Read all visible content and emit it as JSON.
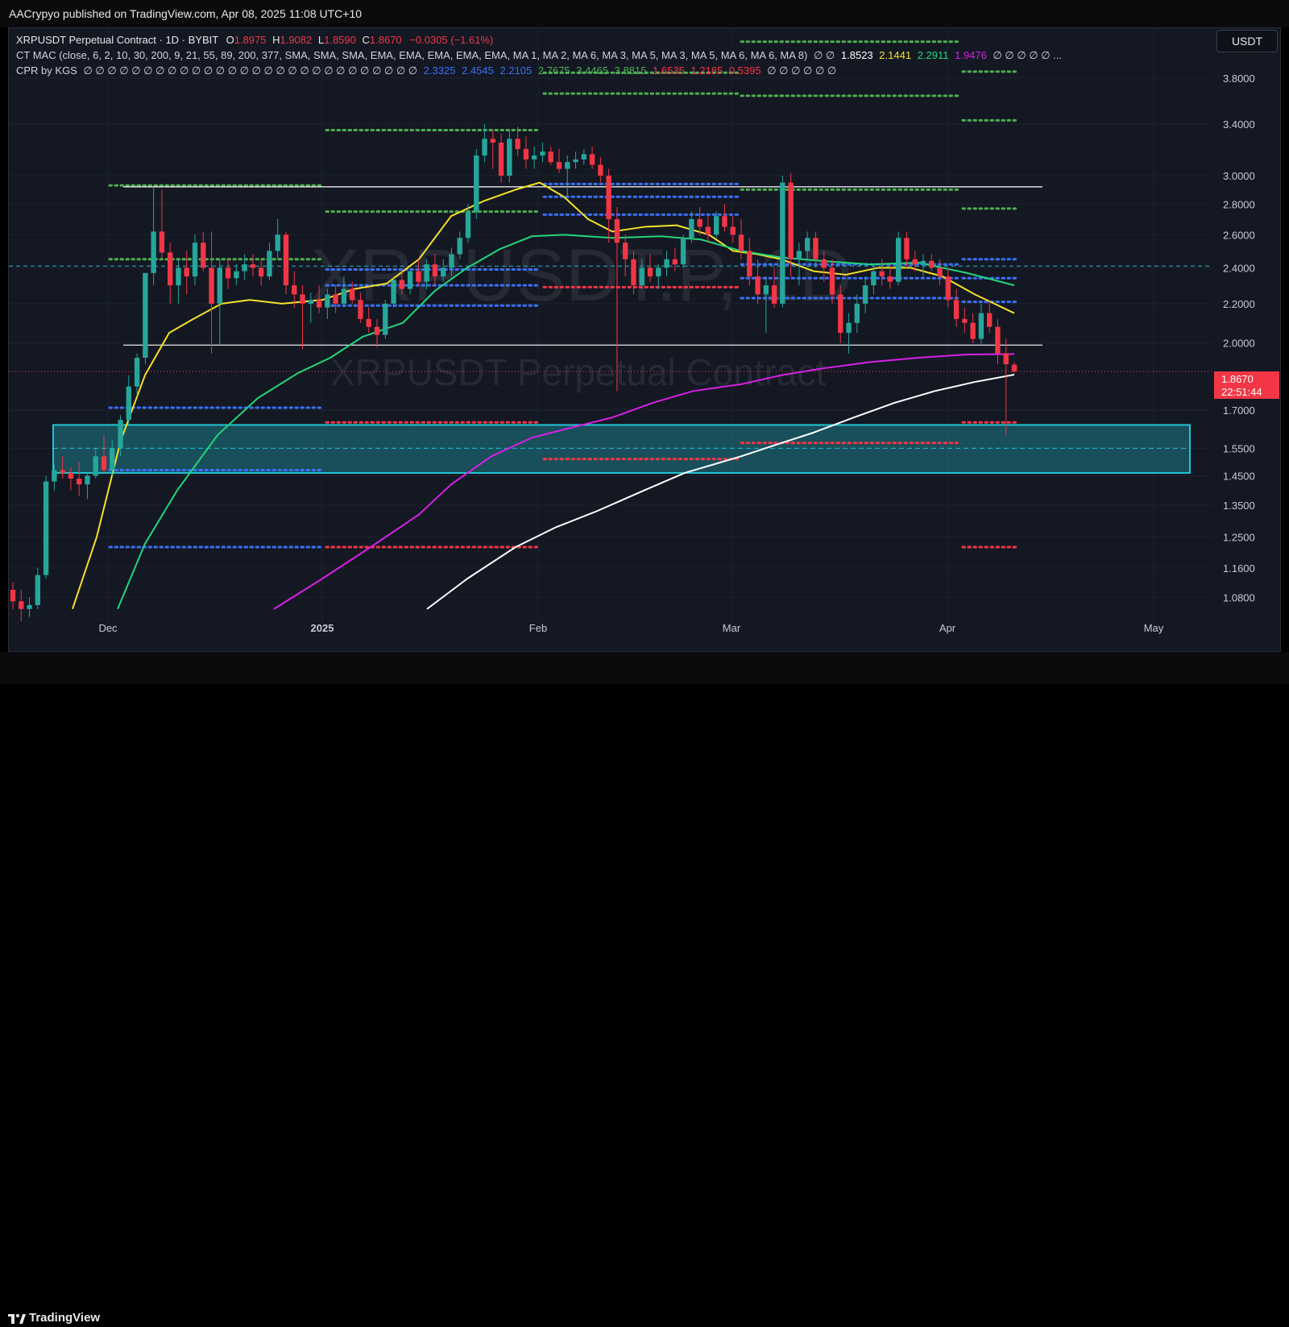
{
  "publisher": "AACrypyo published on TradingView.com, Apr 08, 2025 11:08 UTC+10",
  "legend": {
    "symbol": "XRPUSDT Perpetual Contract · 1D · BYBIT",
    "o_label": "O",
    "o": "1.8975",
    "h_label": "H",
    "h": "1.9082",
    "l_label": "L",
    "l": "1.8590",
    "c_label": "C",
    "c": "1.8670",
    "change": "−0.0305 (−1.61%)",
    "ctmac_label": "CT MAC (close, 6, 2, 10, 30, 200, 9, 21, 55, 89, 200, 377, SMA, SMA, SMA, EMA, EMA, EMA, EMA, EMA, MA 1, MA 2, MA 6, MA 3, MA 5, MA 3, MA 5, MA 6, MA 6, MA 8)",
    "ctmac_empty_a": "∅ ∅",
    "ctmac_v1": "1.8523",
    "ctmac_v2": "2.1441",
    "ctmac_v3": "2.2911",
    "ctmac_v4": "1.9476",
    "ctmac_empty_b": "∅ ∅ ∅ ∅ ∅ ...",
    "cpr_label": "CPR by KGS",
    "cpr_empty_a": "∅ ∅ ∅ ∅ ∅ ∅ ∅ ∅ ∅ ∅ ∅ ∅ ∅ ∅ ∅ ∅ ∅ ∅ ∅ ∅ ∅ ∅ ∅ ∅ ∅ ∅ ∅ ∅",
    "cpr_b1": "2.3325",
    "cpr_b2": "2.4545",
    "cpr_b3": "2.2105",
    "cpr_g1": "2.7675",
    "cpr_g2": "3.4465",
    "cpr_g3": "3.8815",
    "cpr_r1": "1.6535",
    "cpr_r2": "1.2185",
    "cpr_r3": "0.5395",
    "cpr_empty_b": "∅ ∅ ∅ ∅ ∅ ∅"
  },
  "currency_button": "USDT",
  "last_price": "1.8670",
  "countdown": "22:51:44",
  "watermark_big": "XRPUSDT.P, 1D",
  "watermark_small": "XRPUSDT Perpetual Contract",
  "footer_brand": "TradingView",
  "colors": {
    "up": "#26a69a",
    "down": "#f23645",
    "bg": "#141823",
    "yellow": "#f5e12a",
    "green": "#22d67a",
    "magenta": "#d81fe6",
    "white": "#ffffff",
    "zone": "#21c4d4"
  },
  "chart_data": {
    "type": "candlestick",
    "price_axis": [
      "3.8000",
      "3.4000",
      "3.0000",
      "2.8000",
      "2.6000",
      "2.4000",
      "2.2000",
      "2.0000",
      "1.7000",
      "1.5500",
      "1.4500",
      "1.3500",
      "1.2500",
      "1.1600",
      "1.0800"
    ],
    "time_axis": [
      "Dec",
      "2025",
      "Feb",
      "Mar",
      "Apr",
      "May"
    ],
    "scale": "log",
    "ohlc": [
      [
        1.1,
        1.12,
        1.05,
        1.07
      ],
      [
        1.07,
        1.1,
        1.02,
        1.05
      ],
      [
        1.05,
        1.08,
        1.03,
        1.06
      ],
      [
        1.06,
        1.16,
        1.05,
        1.14
      ],
      [
        1.14,
        1.45,
        1.13,
        1.43
      ],
      [
        1.43,
        1.49,
        1.4,
        1.47
      ],
      [
        1.47,
        1.52,
        1.44,
        1.46
      ],
      [
        1.46,
        1.48,
        1.4,
        1.44
      ],
      [
        1.44,
        1.5,
        1.38,
        1.42
      ],
      [
        1.42,
        1.46,
        1.37,
        1.45
      ],
      [
        1.45,
        1.55,
        1.44,
        1.52
      ],
      [
        1.52,
        1.6,
        1.46,
        1.47
      ],
      [
        1.47,
        1.58,
        1.45,
        1.55
      ],
      [
        1.55,
        1.68,
        1.52,
        1.66
      ],
      [
        1.66,
        1.85,
        1.64,
        1.8
      ],
      [
        1.8,
        1.95,
        1.76,
        1.93
      ],
      [
        1.93,
        2.2,
        1.9,
        2.37
      ],
      [
        2.37,
        2.92,
        2.3,
        2.62
      ],
      [
        2.62,
        2.9,
        2.45,
        2.49
      ],
      [
        2.49,
        2.55,
        2.2,
        2.3
      ],
      [
        2.3,
        2.45,
        2.2,
        2.4
      ],
      [
        2.4,
        2.5,
        2.25,
        2.35
      ],
      [
        2.35,
        2.6,
        2.3,
        2.55
      ],
      [
        2.55,
        2.62,
        2.38,
        2.4
      ],
      [
        2.4,
        2.62,
        1.95,
        2.2
      ],
      [
        2.2,
        2.45,
        1.99,
        2.4
      ],
      [
        2.4,
        2.45,
        2.28,
        2.34
      ],
      [
        2.34,
        2.42,
        2.3,
        2.38
      ],
      [
        2.38,
        2.48,
        2.33,
        2.42
      ],
      [
        2.42,
        2.48,
        2.35,
        2.4
      ],
      [
        2.4,
        2.45,
        2.3,
        2.35
      ],
      [
        2.35,
        2.55,
        2.33,
        2.5
      ],
      [
        2.5,
        2.7,
        2.45,
        2.6
      ],
      [
        2.6,
        2.62,
        2.25,
        2.3
      ],
      [
        2.3,
        2.38,
        2.18,
        2.25
      ],
      [
        2.25,
        2.3,
        1.97,
        2.2
      ],
      [
        2.2,
        2.26,
        2.1,
        2.22
      ],
      [
        2.22,
        2.3,
        2.15,
        2.18
      ],
      [
        2.18,
        2.28,
        2.12,
        2.25
      ],
      [
        2.25,
        2.3,
        2.15,
        2.2
      ],
      [
        2.2,
        2.35,
        2.18,
        2.28
      ],
      [
        2.28,
        2.32,
        2.2,
        2.22
      ],
      [
        2.22,
        2.26,
        2.1,
        2.12
      ],
      [
        2.12,
        2.18,
        2.05,
        2.08
      ],
      [
        2.08,
        2.12,
        1.98,
        2.04
      ],
      [
        2.04,
        2.22,
        2.02,
        2.2
      ],
      [
        2.2,
        2.35,
        2.18,
        2.33
      ],
      [
        2.33,
        2.38,
        2.25,
        2.28
      ],
      [
        2.28,
        2.4,
        2.25,
        2.38
      ],
      [
        2.38,
        2.45,
        2.3,
        2.32
      ],
      [
        2.32,
        2.45,
        2.28,
        2.42
      ],
      [
        2.42,
        2.48,
        2.3,
        2.35
      ],
      [
        2.35,
        2.45,
        2.32,
        2.4
      ],
      [
        2.4,
        2.52,
        2.35,
        2.48
      ],
      [
        2.48,
        2.62,
        2.45,
        2.58
      ],
      [
        2.58,
        2.8,
        2.55,
        2.75
      ],
      [
        2.75,
        3.2,
        2.7,
        3.15
      ],
      [
        3.15,
        3.4,
        3.1,
        3.28
      ],
      [
        3.28,
        3.35,
        3.05,
        3.25
      ],
      [
        3.25,
        3.32,
        2.95,
        3.0
      ],
      [
        3.0,
        3.35,
        2.95,
        3.28
      ],
      [
        3.28,
        3.38,
        3.15,
        3.2
      ],
      [
        3.2,
        3.3,
        3.05,
        3.12
      ],
      [
        3.12,
        3.22,
        3.05,
        3.15
      ],
      [
        3.15,
        3.25,
        3.1,
        3.18
      ],
      [
        3.18,
        3.22,
        3.08,
        3.1
      ],
      [
        3.1,
        3.2,
        3.02,
        3.05
      ],
      [
        3.05,
        3.15,
        2.85,
        3.1
      ],
      [
        3.1,
        3.18,
        3.05,
        3.12
      ],
      [
        3.12,
        3.2,
        3.08,
        3.16
      ],
      [
        3.16,
        3.22,
        3.05,
        3.08
      ],
      [
        3.08,
        3.14,
        2.95,
        3.0
      ],
      [
        3.0,
        3.05,
        2.55,
        2.7
      ],
      [
        2.7,
        2.78,
        1.78,
        2.55
      ],
      [
        2.55,
        2.6,
        2.35,
        2.45
      ],
      [
        2.45,
        2.5,
        2.25,
        2.3
      ],
      [
        2.3,
        2.45,
        2.28,
        2.4
      ],
      [
        2.4,
        2.48,
        2.32,
        2.35
      ],
      [
        2.35,
        2.42,
        2.28,
        2.4
      ],
      [
        2.4,
        2.5,
        2.35,
        2.45
      ],
      [
        2.45,
        2.52,
        2.38,
        2.42
      ],
      [
        2.42,
        2.6,
        2.4,
        2.58
      ],
      [
        2.58,
        2.75,
        2.55,
        2.7
      ],
      [
        2.7,
        2.78,
        2.6,
        2.65
      ],
      [
        2.65,
        2.72,
        2.55,
        2.6
      ],
      [
        2.6,
        2.75,
        2.58,
        2.72
      ],
      [
        2.72,
        2.8,
        2.62,
        2.65
      ],
      [
        2.65,
        2.72,
        2.55,
        2.6
      ],
      [
        2.6,
        2.7,
        2.45,
        2.5
      ],
      [
        2.5,
        2.58,
        2.3,
        2.35
      ],
      [
        2.35,
        2.45,
        2.2,
        2.25
      ],
      [
        2.25,
        2.35,
        2.05,
        2.3
      ],
      [
        2.3,
        2.4,
        2.18,
        2.2
      ],
      [
        2.2,
        3.0,
        2.18,
        2.95
      ],
      [
        2.95,
        3.02,
        2.35,
        2.45
      ],
      [
        2.45,
        2.55,
        2.3,
        2.5
      ],
      [
        2.5,
        2.62,
        2.45,
        2.58
      ],
      [
        2.58,
        2.62,
        2.4,
        2.45
      ],
      [
        2.45,
        2.5,
        2.32,
        2.4
      ],
      [
        2.4,
        2.45,
        2.2,
        2.25
      ],
      [
        2.25,
        2.3,
        2.0,
        2.05
      ],
      [
        2.05,
        2.15,
        1.95,
        2.1
      ],
      [
        2.1,
        2.25,
        2.05,
        2.2
      ],
      [
        2.2,
        2.35,
        2.15,
        2.3
      ],
      [
        2.3,
        2.42,
        2.25,
        2.38
      ],
      [
        2.38,
        2.45,
        2.3,
        2.35
      ],
      [
        2.35,
        2.42,
        2.28,
        2.32
      ],
      [
        2.32,
        2.62,
        2.3,
        2.58
      ],
      [
        2.58,
        2.62,
        2.4,
        2.45
      ],
      [
        2.45,
        2.5,
        2.38,
        2.42
      ],
      [
        2.42,
        2.48,
        2.35,
        2.44
      ],
      [
        2.44,
        2.48,
        2.38,
        2.4
      ],
      [
        2.4,
        2.45,
        2.3,
        2.35
      ],
      [
        2.35,
        2.4,
        2.18,
        2.22
      ],
      [
        2.22,
        2.28,
        2.08,
        2.12
      ],
      [
        2.12,
        2.18,
        2.05,
        2.1
      ],
      [
        2.1,
        2.15,
        2.0,
        2.02
      ],
      [
        2.02,
        2.2,
        1.99,
        2.15
      ],
      [
        2.15,
        2.22,
        2.05,
        2.08
      ],
      [
        2.08,
        2.12,
        1.9,
        1.95
      ],
      [
        1.95,
        2.02,
        1.6,
        1.9
      ],
      [
        1.8975,
        1.9082,
        1.859,
        1.867
      ]
    ]
  }
}
